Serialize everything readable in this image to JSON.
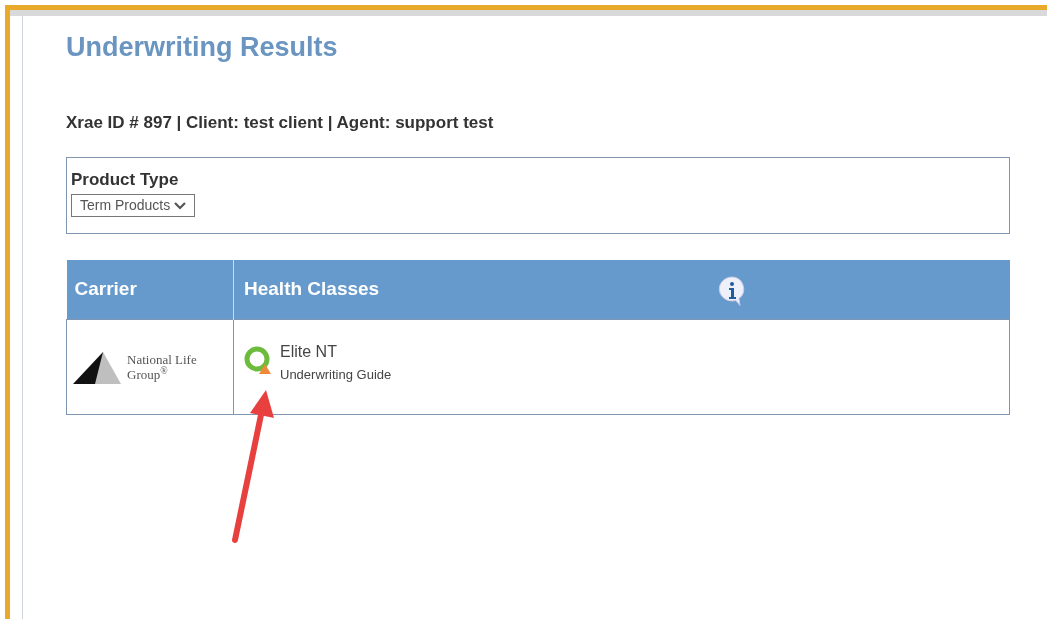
{
  "title": "Underwriting Results",
  "info_line": "Xrae ID # 897 | Client: test client | Agent: support test",
  "product_type": {
    "label": "Product Type",
    "value": "Term Products"
  },
  "table": {
    "columns": [
      "Carrier",
      "Health Classes"
    ],
    "rows": [
      {
        "carrier_logo": [
          "National Life",
          "Group$^{®}$"
        ],
        "health_class": "Elite NT",
        "guide_link": "Underwriting Guide"
      }
    ]
  }
}
